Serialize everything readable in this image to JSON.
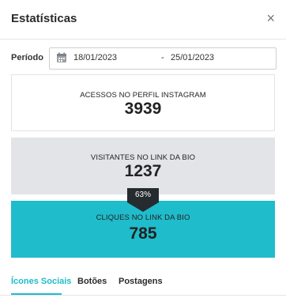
{
  "modal": {
    "title": "Estatísticas",
    "close_label": "×"
  },
  "period": {
    "label": "Período",
    "start": "18/01/2023",
    "separator": "-",
    "end": "25/01/2023"
  },
  "stats": {
    "profile": {
      "label": "ACESSOS NO PERFIL INSTAGRAM",
      "value": "3939"
    },
    "visitors": {
      "label": "VISITANTES NO LINK DA BIO",
      "value": "1237"
    },
    "conversion": "63%",
    "clicks": {
      "label": "CLIQUES NO LINK DA BIO",
      "value": "785"
    }
  },
  "tabs": [
    {
      "label": "Ícones Sociais",
      "active": true
    },
    {
      "label": "Botões",
      "active": false
    },
    {
      "label": "Postagens",
      "active": false
    }
  ],
  "colors": {
    "accent": "#1fbccb",
    "visitors_bg": "#e2e4e8",
    "badge_bg": "#262b30"
  }
}
